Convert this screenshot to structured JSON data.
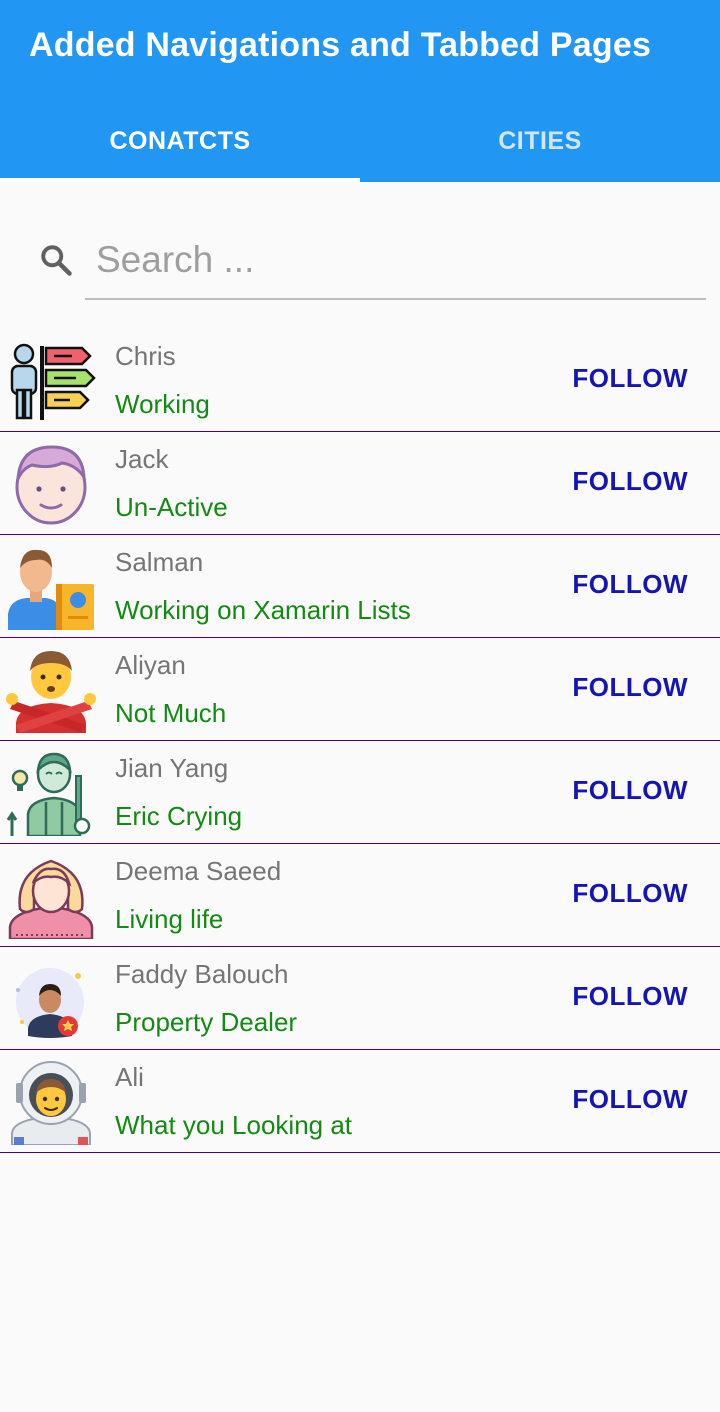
{
  "app": {
    "title": "Added Navigations and Tabbed Pages",
    "accent_color": "#2196f3"
  },
  "tabs": [
    {
      "label": "CONATCTS",
      "selected": true
    },
    {
      "label": "CITIES",
      "selected": false
    }
  ],
  "search": {
    "icon": "search-icon",
    "placeholder": "Search ...",
    "value": ""
  },
  "contacts": [
    {
      "name": "Chris",
      "status": "Working",
      "action": "FOLLOW",
      "avatar": "signpost-person-avatar"
    },
    {
      "name": "Jack",
      "status": "Un-Active",
      "action": "FOLLOW",
      "avatar": "boy-face-avatar"
    },
    {
      "name": "Salman",
      "status": "Working on Xamarin Lists",
      "action": "FOLLOW",
      "avatar": "man-with-book-avatar"
    },
    {
      "name": "Aliyan",
      "status": "Not Much",
      "action": "FOLLOW",
      "avatar": "person-gesturing-no-avatar"
    },
    {
      "name": "Jian Yang",
      "status": "Eric Crying",
      "action": "FOLLOW",
      "avatar": "man-with-ideas-avatar"
    },
    {
      "name": "Deema Saeed",
      "status": "Living life",
      "action": "FOLLOW",
      "avatar": "woman-avatar"
    },
    {
      "name": "Faddy Balouch",
      "status": "Property Dealer",
      "action": "FOLLOW",
      "avatar": "man-with-badge-avatar"
    },
    {
      "name": "Ali",
      "status": "What you Looking at",
      "action": "FOLLOW",
      "avatar": "astronaut-avatar"
    }
  ],
  "colors": {
    "status_text": "#138a13",
    "follow_text": "#1515b4",
    "divider": "#4b0082"
  }
}
